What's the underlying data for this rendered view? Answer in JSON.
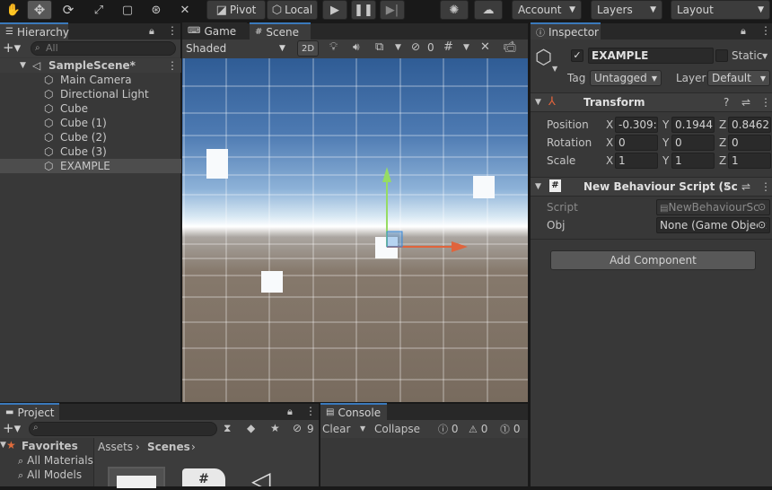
{
  "toolbar": {
    "pivot": "Pivot",
    "local": "Local",
    "account": "Account",
    "layers": "Layers",
    "layout": "Layout",
    "icons": [
      "hand-icon",
      "move-icon",
      "rotate-icon",
      "scale-icon",
      "rect-icon",
      "transform-icon",
      "custom-tool-icon",
      "play-icon",
      "pause-icon",
      "step-icon",
      "collab-icon",
      "cloud-icon"
    ]
  },
  "hierarchy": {
    "tab": "Hierarchy",
    "search_placeholder": "All",
    "scene": "SampleScene*",
    "items": [
      "Main Camera",
      "Directional Light",
      "Cube",
      "Cube (1)",
      "Cube (2)",
      "Cube (3)",
      "EXAMPLE"
    ],
    "selected": "EXAMPLE"
  },
  "scene_view": {
    "tab_game": "Game",
    "tab_scene": "Scene",
    "shading": "Shaded",
    "mode_2d": "2D",
    "hidden_count": "0"
  },
  "inspector": {
    "tab": "Inspector",
    "name": "EXAMPLE",
    "static_label": "Static",
    "tag_label": "Tag",
    "tag_value": "Untagged",
    "layer_label": "Layer",
    "layer_value": "Default",
    "transform": {
      "title": "Transform",
      "position_label": "Position",
      "rotation_label": "Rotation",
      "scale_label": "Scale",
      "position": [
        "-0.309:",
        "0.1944!",
        "0.8462:"
      ],
      "rotation": [
        "0",
        "0",
        "0"
      ],
      "scale": [
        "1",
        "1",
        "1"
      ],
      "axes": [
        "X",
        "Y",
        "Z"
      ]
    },
    "script_component": {
      "title": "New Behaviour Script (Sc",
      "script_label": "Script",
      "script_value": "NewBehaviourSc",
      "obj_label": "Obj",
      "obj_value": "None (Game Object"
    },
    "add_component": "Add Component"
  },
  "project": {
    "tab": "Project",
    "favorites": "Favorites",
    "fav_items": [
      "All Materials",
      "All Models"
    ],
    "breadcrumb_assets": "Assets",
    "breadcrumb_scenes": "Scenes",
    "hidden_count": "9"
  },
  "console": {
    "tab": "Console",
    "clear": "Clear",
    "collapse": "Collapse",
    "log_count": "0",
    "warn_count": "0",
    "error_count": "0"
  },
  "colors": {
    "accent": "#2c5d87",
    "panel": "#383838",
    "toolbar": "#191919",
    "selected_row": "#4d4d4d",
    "gizmo_x": "#e0643c",
    "gizmo_y": "#96dc64",
    "gizmo_z": "#3c8cdc"
  }
}
